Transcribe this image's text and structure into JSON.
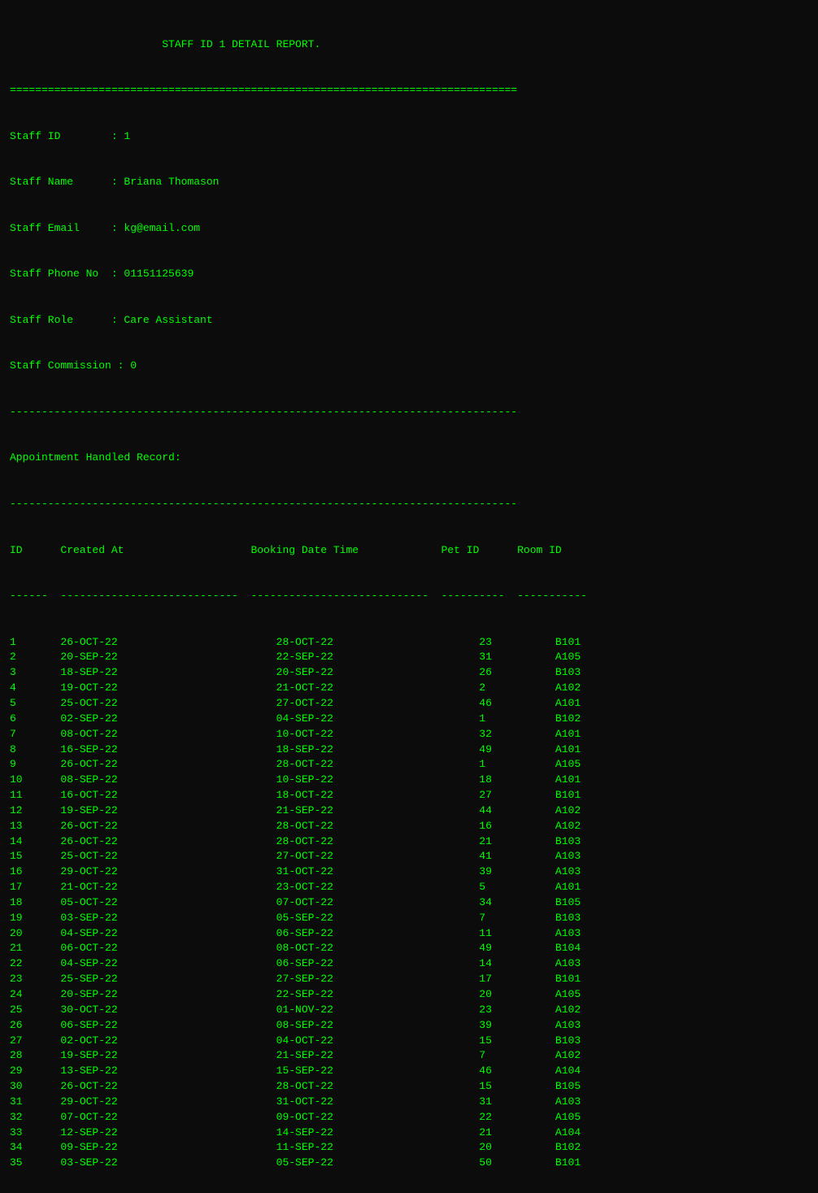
{
  "report": {
    "title": "                        STAFF ID 1 DETAIL REPORT.",
    "divider_eq": "================================================================================",
    "staff": {
      "id_label": "Staff ID",
      "id_value": ": 1",
      "name_label": "Staff Name",
      "name_value": ": Briana Thomason",
      "email_label": "Staff Email",
      "email_value": ": kg@email.com",
      "phone_label": "Staff Phone No",
      "phone_value": ": 01151125639",
      "role_label": "Staff Role",
      "role_value": ": Care Assistant",
      "commission_label": "Staff Commission",
      "commission_value": ": 0"
    },
    "divider_dash_long": "--------------------------------------------------------------------------------",
    "appointment_header": "Appointment Handled Record:",
    "table_divider": "--------------------------------------------------------------------------------",
    "col_headers": "ID      Created At                    Booking Date Time             Pet ID      Room ID",
    "col_underline": "------  ----------------------------  ----------------------------  ----------  -----------",
    "rows": [
      {
        "id": "1",
        "created": "26-OCT-22",
        "booking": "28-OCT-22",
        "pet": "23",
        "room": "B101"
      },
      {
        "id": "2",
        "created": "20-SEP-22",
        "booking": "22-SEP-22",
        "pet": "31",
        "room": "A105"
      },
      {
        "id": "3",
        "created": "18-SEP-22",
        "booking": "20-SEP-22",
        "pet": "26",
        "room": "B103"
      },
      {
        "id": "4",
        "created": "19-OCT-22",
        "booking": "21-OCT-22",
        "pet": "2",
        "room": "A102"
      },
      {
        "id": "5",
        "created": "25-OCT-22",
        "booking": "27-OCT-22",
        "pet": "46",
        "room": "A101"
      },
      {
        "id": "6",
        "created": "02-SEP-22",
        "booking": "04-SEP-22",
        "pet": "1",
        "room": "B102"
      },
      {
        "id": "7",
        "created": "08-OCT-22",
        "booking": "10-OCT-22",
        "pet": "32",
        "room": "A101"
      },
      {
        "id": "8",
        "created": "16-SEP-22",
        "booking": "18-SEP-22",
        "pet": "49",
        "room": "A101"
      },
      {
        "id": "9",
        "created": "26-OCT-22",
        "booking": "28-OCT-22",
        "pet": "1",
        "room": "A105"
      },
      {
        "id": "10",
        "created": "08-SEP-22",
        "booking": "10-SEP-22",
        "pet": "18",
        "room": "A101"
      },
      {
        "id": "11",
        "created": "16-OCT-22",
        "booking": "18-OCT-22",
        "pet": "27",
        "room": "B101"
      },
      {
        "id": "12",
        "created": "19-SEP-22",
        "booking": "21-SEP-22",
        "pet": "44",
        "room": "A102"
      },
      {
        "id": "13",
        "created": "26-OCT-22",
        "booking": "28-OCT-22",
        "pet": "16",
        "room": "A102"
      },
      {
        "id": "14",
        "created": "26-OCT-22",
        "booking": "28-OCT-22",
        "pet": "21",
        "room": "B103"
      },
      {
        "id": "15",
        "created": "25-OCT-22",
        "booking": "27-OCT-22",
        "pet": "41",
        "room": "A103"
      },
      {
        "id": "16",
        "created": "29-OCT-22",
        "booking": "31-OCT-22",
        "pet": "39",
        "room": "A103"
      },
      {
        "id": "17",
        "created": "21-OCT-22",
        "booking": "23-OCT-22",
        "pet": "5",
        "room": "A101"
      },
      {
        "id": "18",
        "created": "05-OCT-22",
        "booking": "07-OCT-22",
        "pet": "34",
        "room": "B105"
      },
      {
        "id": "19",
        "created": "03-SEP-22",
        "booking": "05-SEP-22",
        "pet": "7",
        "room": "B103"
      },
      {
        "id": "20",
        "created": "04-SEP-22",
        "booking": "06-SEP-22",
        "pet": "11",
        "room": "A103"
      },
      {
        "id": "21",
        "created": "06-OCT-22",
        "booking": "08-OCT-22",
        "pet": "49",
        "room": "B104"
      },
      {
        "id": "22",
        "created": "04-SEP-22",
        "booking": "06-SEP-22",
        "pet": "14",
        "room": "A103"
      },
      {
        "id": "23",
        "created": "25-SEP-22",
        "booking": "27-SEP-22",
        "pet": "17",
        "room": "B101"
      },
      {
        "id": "24",
        "created": "20-SEP-22",
        "booking": "22-SEP-22",
        "pet": "20",
        "room": "A105"
      },
      {
        "id": "25",
        "created": "30-OCT-22",
        "booking": "01-NOV-22",
        "pet": "23",
        "room": "A102"
      },
      {
        "id": "26",
        "created": "06-SEP-22",
        "booking": "08-SEP-22",
        "pet": "39",
        "room": "A103"
      },
      {
        "id": "27",
        "created": "02-OCT-22",
        "booking": "04-OCT-22",
        "pet": "15",
        "room": "B103"
      },
      {
        "id": "28",
        "created": "19-SEP-22",
        "booking": "21-SEP-22",
        "pet": "7",
        "room": "A102"
      },
      {
        "id": "29",
        "created": "13-SEP-22",
        "booking": "15-SEP-22",
        "pet": "46",
        "room": "A104"
      },
      {
        "id": "30",
        "created": "26-OCT-22",
        "booking": "28-OCT-22",
        "pet": "15",
        "room": "B105"
      },
      {
        "id": "31",
        "created": "29-OCT-22",
        "booking": "31-OCT-22",
        "pet": "31",
        "room": "A103"
      },
      {
        "id": "32",
        "created": "07-OCT-22",
        "booking": "09-OCT-22",
        "pet": "22",
        "room": "A105"
      },
      {
        "id": "33",
        "created": "12-SEP-22",
        "booking": "14-SEP-22",
        "pet": "21",
        "room": "A104"
      },
      {
        "id": "34",
        "created": "09-SEP-22",
        "booking": "11-SEP-22",
        "pet": "20",
        "room": "B102"
      },
      {
        "id": "35",
        "created": "03-SEP-22",
        "booking": "05-SEP-22",
        "pet": "50",
        "room": "B101"
      }
    ]
  }
}
